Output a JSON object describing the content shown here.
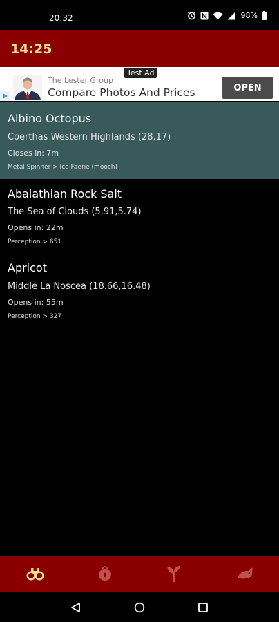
{
  "status_bar": {
    "time": "20:32",
    "battery": "98%",
    "icons": [
      "alarm-icon",
      "nfc-icon",
      "wifi-icon",
      "signal-icon",
      "battery-icon"
    ]
  },
  "app_bar": {
    "title": "14:25"
  },
  "ad": {
    "label": "Test Ad",
    "company": "The Lester Group",
    "headline": "Compare Photos And Prices",
    "cta": "OPEN"
  },
  "items": [
    {
      "name": "Albino Octopus",
      "location": "Coerthas Western Highlands (28,17)",
      "timer": "Closes in: 7m",
      "requirement": "Metal Spinner > Ice Faerie (mooch)"
    },
    {
      "name": "Abalathian Rock Salt",
      "location": "The Sea of Clouds (5.91,5.74)",
      "timer": "Opens in: 22m",
      "requirement": "Perception > 651"
    },
    {
      "name": "Apricot",
      "location": "Middle La Noscea (18.66,16.48)",
      "timer": "Opens in: 55m",
      "requirement": "Perception > 327"
    }
  ],
  "bottom_nav": {
    "items": [
      "binoculars-icon",
      "herb-bag-icon",
      "sprout-icon",
      "fish-icon"
    ],
    "active_color": "#f3e08c",
    "inactive_color": "#c25050"
  },
  "colors": {
    "app_bar": "#8a0000",
    "highlight_row": "#385a5a",
    "title_text": "#f3e08c"
  }
}
